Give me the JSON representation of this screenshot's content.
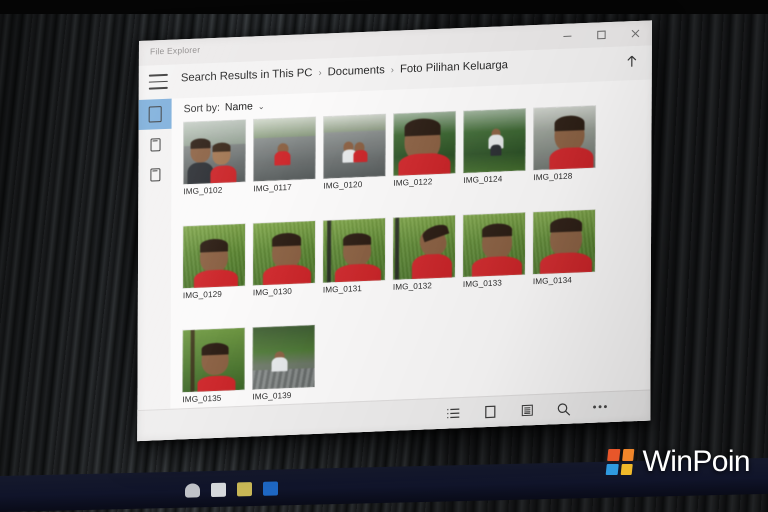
{
  "window": {
    "app_title": "File Explorer",
    "controls": [
      {
        "name": "minimize",
        "glyph": "–"
      },
      {
        "name": "maximize",
        "glyph": "□"
      },
      {
        "name": "close",
        "glyph": "×"
      }
    ],
    "menu_icon": "hamburger-icon",
    "up_icon": "up-arrow-icon"
  },
  "breadcrumb": {
    "items": [
      "Search Results in This PC",
      "Documents",
      "Foto Pilihan Keluarga"
    ],
    "separator": "›"
  },
  "rail": {
    "items": [
      {
        "name": "sidebar-item-pictures",
        "selected": true
      },
      {
        "name": "sidebar-item-device",
        "selected": false
      },
      {
        "name": "sidebar-item-storage",
        "selected": false
      }
    ]
  },
  "sortbar": {
    "label": "Sort by:",
    "value": "Name",
    "chevron": "⌄"
  },
  "files": {
    "rows": [
      [
        {
          "name": "IMG_0102",
          "scene": "two-kids-street"
        },
        {
          "name": "IMG_0117",
          "scene": "kid-crouch-road"
        },
        {
          "name": "IMG_0120",
          "scene": "two-kids-road"
        },
        {
          "name": "IMG_0122",
          "scene": "closeup-red-shirt"
        },
        {
          "name": "IMG_0124",
          "scene": "kid-white-shirt-garden"
        },
        {
          "name": "IMG_0128",
          "scene": "kid-red-shirt-street"
        }
      ],
      [
        {
          "name": "IMG_0129",
          "scene": "kid-grass"
        },
        {
          "name": "IMG_0130",
          "scene": "kid-grass-smile"
        },
        {
          "name": "IMG_0131",
          "scene": "kid-grass-pole"
        },
        {
          "name": "IMG_0132",
          "scene": "kid-looking-up"
        },
        {
          "name": "IMG_0133",
          "scene": "kid-grass-grin"
        },
        {
          "name": "IMG_0134",
          "scene": "kid-grass-closeup"
        }
      ],
      [
        {
          "name": "IMG_0135",
          "scene": "kid-profile-grass"
        },
        {
          "name": "IMG_0139",
          "scene": "kid-crouch-tiles"
        }
      ]
    ]
  },
  "bottom_toolbar": {
    "buttons": [
      {
        "name": "details-view-button",
        "icon": "list-numbered-icon"
      },
      {
        "name": "tiles-view-button",
        "icon": "square-icon"
      },
      {
        "name": "list-view-button",
        "icon": "lines-icon"
      },
      {
        "name": "search-button",
        "icon": "search-icon"
      },
      {
        "name": "more-button",
        "icon": "ellipsis-icon",
        "glyph": "•••"
      }
    ]
  },
  "taskbar": {
    "icons": [
      {
        "name": "taskbar-app-1",
        "color": "#cfd3d6"
      },
      {
        "name": "taskbar-app-2",
        "color": "#e7eaec"
      },
      {
        "name": "taskbar-app-3",
        "color": "#d8c65a"
      },
      {
        "name": "taskbar-app-4",
        "color": "#1f6fd0"
      }
    ]
  },
  "watermark": {
    "text": "WinPoin",
    "logo_colors": [
      "#e8562a",
      "#f0862a",
      "#2f9ae0",
      "#f0b92a"
    ]
  },
  "colors": {
    "accent_selected": "#7fb0dc",
    "window_chrome": "#f2f2f2",
    "content_bg": "#fbfafa",
    "taskbar": "#10142a"
  }
}
